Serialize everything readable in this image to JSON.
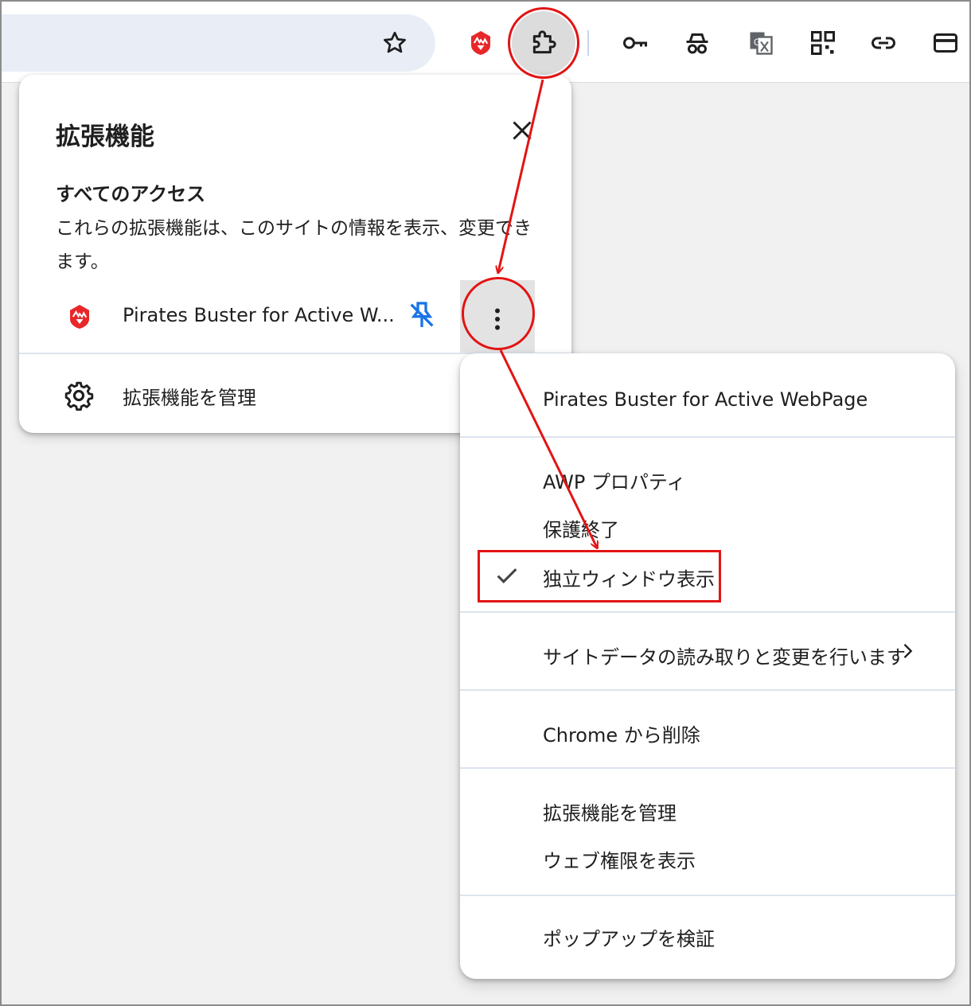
{
  "toolbar": {
    "icons": [
      "star-icon",
      "pirates-buster-icon",
      "puzzle-icon",
      "key-icon",
      "spy-icon",
      "translate-icon",
      "qr-icon",
      "link-icon",
      "card-icon"
    ]
  },
  "extensions_panel": {
    "title": "拡張機能",
    "access_title": "すべてのアクセス",
    "access_desc": "これらの拡張機能は、このサイトの情報を表示、変更できます。",
    "extension_name": "Pirates Buster for Active W...",
    "manage_label": "拡張機能を管理"
  },
  "context_menu": {
    "header": "Pirates Buster for Active WebPage",
    "items": [
      {
        "label": "AWP プロパティ"
      },
      {
        "label": "保護終了"
      },
      {
        "label": "独立ウィンドウ表示",
        "checked": true
      },
      {
        "label": "サイトデータの読み取りと変更を行います",
        "has_submenu": true
      },
      {
        "label": "Chrome から削除"
      },
      {
        "label": "拡張機能を管理"
      },
      {
        "label": "ウェブ権限を表示"
      },
      {
        "label": "ポップアップを検証"
      }
    ]
  },
  "colors": {
    "annotation": "#e31414",
    "pin_accent": "#1a73e8",
    "extension_brand": "#e8272a"
  }
}
